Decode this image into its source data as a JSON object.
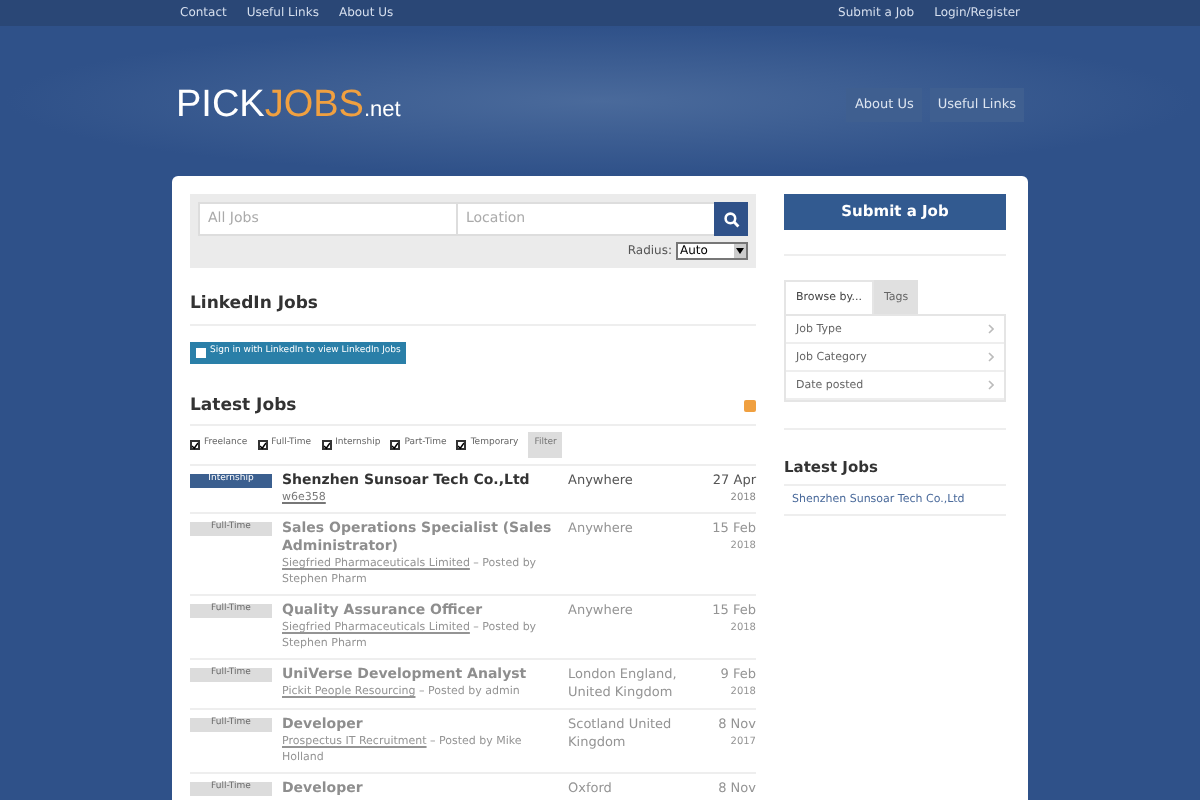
{
  "top_nav": {
    "left": [
      "Contact",
      "Useful Links",
      "About Us"
    ],
    "right": [
      "Submit a Job",
      "Login/Register"
    ]
  },
  "logo": {
    "part_1": "PICK",
    "part_2": "JOBS",
    ".net": ".net"
  },
  "header_buttons": [
    "About Us",
    "Useful Links"
  ],
  "search": {
    "keywords_placeholder": "All Jobs",
    "location_placeholder": "Location",
    "radius_label": "Radius:",
    "radius_value": "Auto"
  },
  "linkedin": {
    "heading": "LinkedIn Jobs",
    "button": "Sign in with LinkedIn to view LinkedIn Jobs"
  },
  "latest": {
    "heading": "Latest Jobs",
    "filters": [
      {
        "label": "Freelance",
        "checked": true
      },
      {
        "label": "Full-Time",
        "checked": true
      },
      {
        "label": "Internship",
        "checked": true
      },
      {
        "label": "Part-Time",
        "checked": true
      },
      {
        "label": "Temporary",
        "checked": true
      }
    ],
    "filter_button": "Filter",
    "jobs": [
      {
        "type": "Internship",
        "kind": "internship",
        "faded": false,
        "title": "Shenzhen Sunsoar Tech Co.,Ltd",
        "company": "w6e358",
        "location": "Anywhere",
        "day": "27 Apr",
        "year": "2018"
      },
      {
        "type": "Full-Time",
        "kind": "full-time",
        "faded": true,
        "title": "Sales Operations Specialist (Sales Administrator)",
        "company": "Siegfried Pharmaceuticals Limited",
        "posted": " – Posted by Stephen Pharm",
        "location": "Anywhere",
        "day": "15 Feb",
        "year": "2018"
      },
      {
        "type": "Full-Time",
        "kind": "full-time",
        "faded": true,
        "title": "Quality Assurance Officer",
        "company": "Siegfried Pharmaceuticals Limited",
        "posted": " – Posted by Stephen Pharm",
        "location": "Anywhere",
        "day": "15 Feb",
        "year": "2018"
      },
      {
        "type": "Full-Time",
        "kind": "full-time",
        "faded": true,
        "title": "UniVerse Development Analyst",
        "company": "Pickit People Resourcing",
        "posted": " – Posted by admin",
        "location": "London England, United Kingdom",
        "day": "9 Feb",
        "year": "2018"
      },
      {
        "type": "Full-Time",
        "kind": "full-time",
        "faded": true,
        "title": "Developer",
        "company": "Prospectus IT Recruitment",
        "posted": " – Posted by Mike Holland",
        "location": "Scotland United Kingdom",
        "day": "8 Nov",
        "year": "2017"
      },
      {
        "type": "Full-Time",
        "kind": "full-time",
        "faded": true,
        "title": "Developer",
        "location": "Oxford",
        "day": "8 Nov"
      }
    ]
  },
  "sidebar": {
    "submit_button": "Submit a Job",
    "tabs": [
      {
        "label": "Browse by...",
        "selected": true
      },
      {
        "label": "Tags",
        "selected": false
      }
    ],
    "browse_items": [
      "Job Type",
      "Job Category",
      "Date posted"
    ],
    "latest_heading": "Latest Jobs",
    "latest_items": [
      "Shenzhen Sunsoar Tech Co.,Ltd"
    ]
  }
}
